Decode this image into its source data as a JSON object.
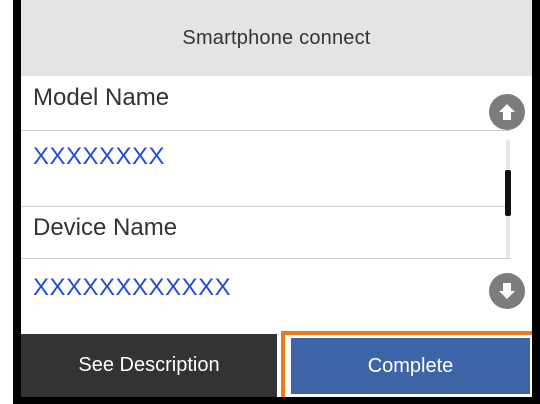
{
  "header": {
    "title": "Smartphone connect"
  },
  "list": {
    "items": [
      {
        "label": "Model Name",
        "value": "XXXXXXXX"
      },
      {
        "label": "Device Name",
        "value": "XXXXXXXXXXXX"
      }
    ]
  },
  "scroll": {
    "up_icon": "arrow-up-icon",
    "down_icon": "arrow-down-icon"
  },
  "buttons": {
    "see_description": "See Description",
    "complete": "Complete"
  },
  "colors": {
    "header_bg": "#e4e4e4",
    "value_text": "#1e4fd6",
    "secondary_button": "#333333",
    "primary_button": "#3e64a8",
    "focus_outline": "#f07a1a"
  }
}
